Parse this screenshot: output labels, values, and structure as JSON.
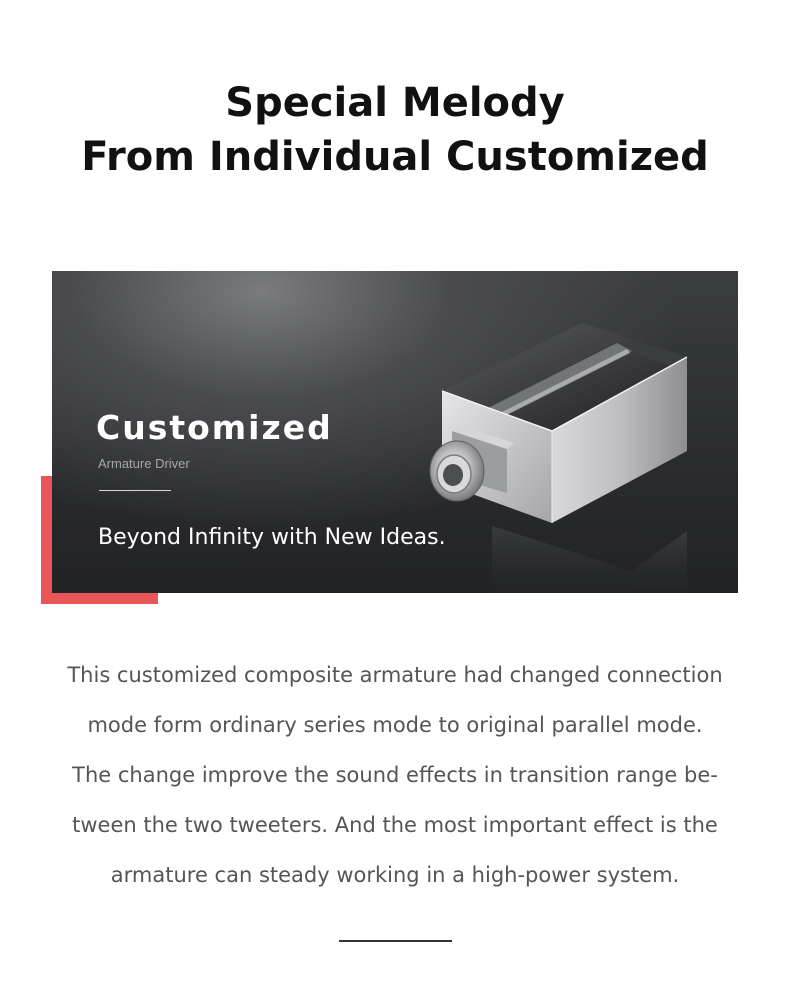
{
  "title": {
    "line1": "Special Melody",
    "line2": "From Individual Customized"
  },
  "banner": {
    "heading": "Customized",
    "subheading": "Armature Driver",
    "tagline": "Beyond Infinity with New Ideas.",
    "product_image": "armature-driver-icon"
  },
  "description": {
    "lines": [
      "This customized composite armature had changed connection",
      "mode form ordinary series mode to original parallel mode.",
      "The change improve the sound effects in transition range be-",
      "tween the two tweeters. And the most important effect is the",
      "armature can steady working in a high-power system."
    ]
  },
  "colors": {
    "accent": "#e8565a",
    "banner_dark": "#2a2b2e",
    "title_text": "#111111",
    "body_text": "#555555"
  }
}
